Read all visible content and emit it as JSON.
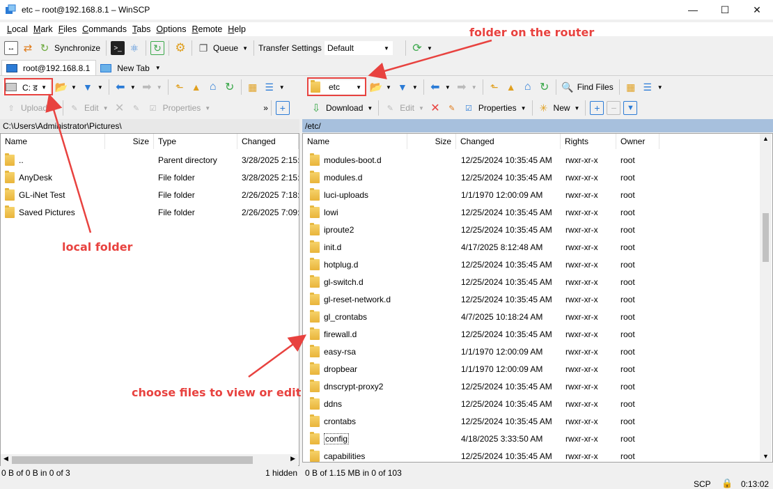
{
  "window": {
    "title": "etc – root@192.168.8.1 – WinSCP"
  },
  "menu": [
    "Local",
    "Mark",
    "Files",
    "Commands",
    "Tabs",
    "Options",
    "Remote",
    "Help"
  ],
  "toolbar": {
    "synchronize": "Synchronize",
    "queue": "Queue",
    "transfer_settings": "Transfer Settings",
    "transfer_profile": "Default"
  },
  "tabs": {
    "session": "root@192.168.8.1",
    "new_tab": "New Tab"
  },
  "local": {
    "drive": "C: ड",
    "path": "C:\\Users\\Administrator\\Pictures\\",
    "toolbar": {
      "upload": "Upload",
      "edit": "Edit",
      "properties": "Properties"
    },
    "columns": {
      "name": "Name",
      "size": "Size",
      "type": "Type",
      "changed": "Changed"
    },
    "rows": [
      {
        "name": "..",
        "size": "",
        "type": "Parent directory",
        "changed": "3/28/2025 2:15:1"
      },
      {
        "name": "AnyDesk",
        "size": "",
        "type": "File folder",
        "changed": "3/28/2025 2:15:1"
      },
      {
        "name": "GL-iNet Test",
        "size": "",
        "type": "File folder",
        "changed": "2/26/2025 7:18:0"
      },
      {
        "name": "Saved Pictures",
        "size": "",
        "type": "File folder",
        "changed": "2/26/2025 7:09:1"
      }
    ],
    "status_left": "0 B of 0 B in 0 of 3",
    "status_right": "1 hidden"
  },
  "remote": {
    "folder": "etc",
    "path": "/etc/",
    "toolbar": {
      "find_files": "Find Files",
      "download": "Download",
      "edit": "Edit",
      "properties": "Properties",
      "new": "New"
    },
    "columns": {
      "name": "Name",
      "size": "Size",
      "changed": "Changed",
      "rights": "Rights",
      "owner": "Owner"
    },
    "rows": [
      {
        "name": "modules-boot.d",
        "changed": "12/25/2024 10:35:45 AM",
        "rights": "rwxr-xr-x",
        "owner": "root"
      },
      {
        "name": "modules.d",
        "changed": "12/25/2024 10:35:45 AM",
        "rights": "rwxr-xr-x",
        "owner": "root"
      },
      {
        "name": "luci-uploads",
        "changed": "1/1/1970 12:00:09 AM",
        "rights": "rwxr-xr-x",
        "owner": "root"
      },
      {
        "name": "lowi",
        "changed": "12/25/2024 10:35:45 AM",
        "rights": "rwxr-xr-x",
        "owner": "root"
      },
      {
        "name": "iproute2",
        "changed": "12/25/2024 10:35:45 AM",
        "rights": "rwxr-xr-x",
        "owner": "root"
      },
      {
        "name": "init.d",
        "changed": "4/17/2025 8:12:48 AM",
        "rights": "rwxr-xr-x",
        "owner": "root"
      },
      {
        "name": "hotplug.d",
        "changed": "12/25/2024 10:35:45 AM",
        "rights": "rwxr-xr-x",
        "owner": "root"
      },
      {
        "name": "gl-switch.d",
        "changed": "12/25/2024 10:35:45 AM",
        "rights": "rwxr-xr-x",
        "owner": "root"
      },
      {
        "name": "gl-reset-network.d",
        "changed": "12/25/2024 10:35:45 AM",
        "rights": "rwxr-xr-x",
        "owner": "root"
      },
      {
        "name": "gl_crontabs",
        "changed": "4/7/2025 10:18:24 AM",
        "rights": "rwxr-xr-x",
        "owner": "root"
      },
      {
        "name": "firewall.d",
        "changed": "12/25/2024 10:35:45 AM",
        "rights": "rwxr-xr-x",
        "owner": "root"
      },
      {
        "name": "easy-rsa",
        "changed": "1/1/1970 12:00:09 AM",
        "rights": "rwxr-xr-x",
        "owner": "root"
      },
      {
        "name": "dropbear",
        "changed": "1/1/1970 12:00:09 AM",
        "rights": "rwxr-xr-x",
        "owner": "root"
      },
      {
        "name": "dnscrypt-proxy2",
        "changed": "12/25/2024 10:35:45 AM",
        "rights": "rwxr-xr-x",
        "owner": "root"
      },
      {
        "name": "ddns",
        "changed": "12/25/2024 10:35:45 AM",
        "rights": "rwxr-xr-x",
        "owner": "root"
      },
      {
        "name": "crontabs",
        "changed": "12/25/2024 10:35:45 AM",
        "rights": "rwxr-xr-x",
        "owner": "root"
      },
      {
        "name": "config",
        "changed": "4/18/2025 3:33:50 AM",
        "rights": "rwxr-xr-x",
        "owner": "root"
      },
      {
        "name": "capabilities",
        "changed": "12/25/2024 10:35:45 AM",
        "rights": "rwxr-xr-x",
        "owner": "root"
      }
    ],
    "status_left": "0 B of 1.15 MB in 0 of 103"
  },
  "statusbar": {
    "protocol": "SCP",
    "timer": "0:13:02"
  },
  "annotations": {
    "router": "folder on the router",
    "local": "local folder",
    "choose": "choose files to view or edit"
  },
  "colors": {
    "annotation": "#e8423f",
    "remote_path_bar": "#a7c0dd"
  }
}
